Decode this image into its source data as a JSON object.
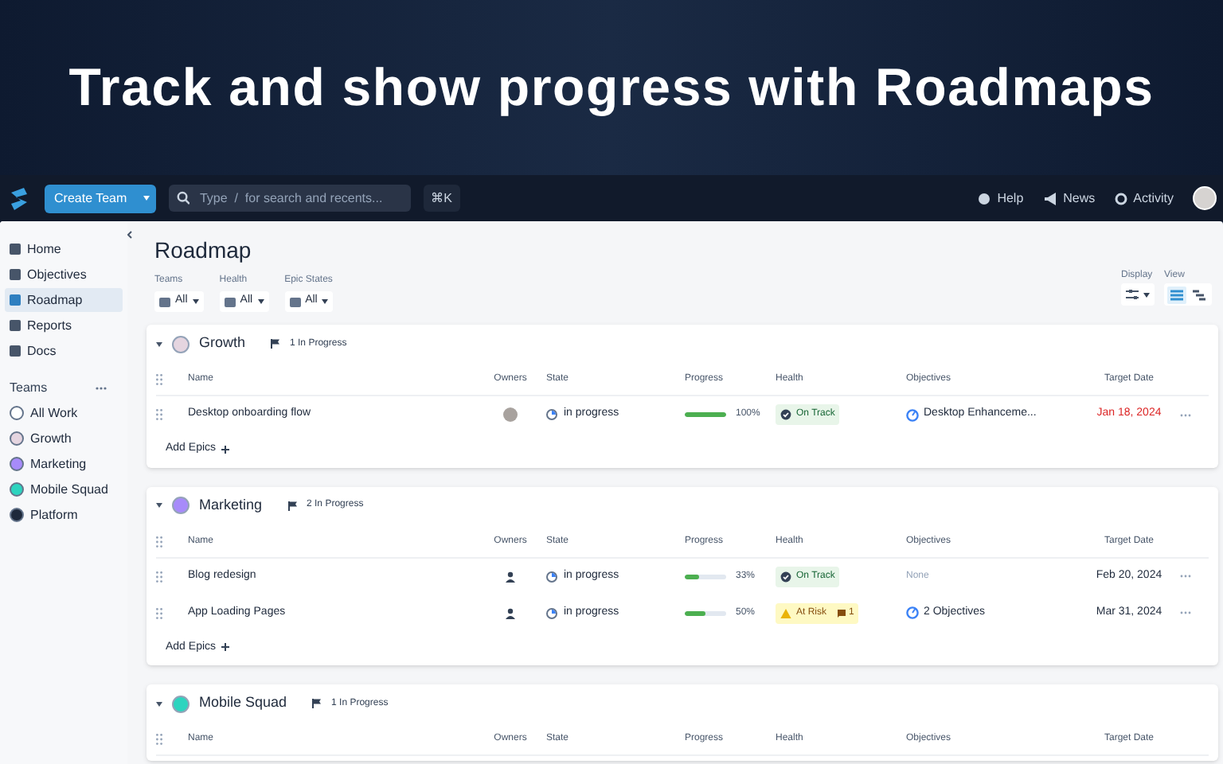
{
  "headline": "Track and show progress with Roadmaps",
  "topbar": {
    "create_button": "Create Team",
    "search": {
      "placeholder": "Type  /  for search and recents..."
    },
    "shortcut": "⌘K",
    "links": [
      "Help",
      "News",
      "Activity"
    ]
  },
  "sidebar": {
    "items": [
      {
        "label": "Home",
        "selected": false
      },
      {
        "label": "Objectives",
        "selected": false
      },
      {
        "label": "Roadmap",
        "selected": true
      },
      {
        "label": "Reports",
        "selected": false
      },
      {
        "label": "Docs",
        "selected": false
      }
    ],
    "teams_heading": "Teams",
    "teams": [
      {
        "label": "All Work",
        "color": "#ffffff"
      },
      {
        "label": "Growth",
        "color": "#e5d5e0"
      },
      {
        "label": "Marketing",
        "color": "#a78bfa"
      },
      {
        "label": "Mobile Squad",
        "color": "#2dd4bf"
      },
      {
        "label": "Platform",
        "color": "#1e293b"
      }
    ]
  },
  "page": {
    "title": "Roadmap",
    "filters": [
      {
        "label": "Teams",
        "value": "All"
      },
      {
        "label": "Health",
        "value": "All"
      },
      {
        "label": "Epic States",
        "value": "All"
      }
    ],
    "display_label": "Display",
    "view_label": "View",
    "views": [
      {
        "selected": true
      },
      {
        "selected": false
      }
    ]
  },
  "groups": [
    {
      "name": "Growth",
      "color": "#e5d5e0",
      "count": "1 In Progress",
      "expanded": true,
      "columns": [
        "Name",
        "Owners",
        "State",
        "Progress",
        "Health",
        "Objectives",
        "Target Date"
      ],
      "add_label": "Add Epics",
      "rows": [
        {
          "name": "Desktop onboarding flow",
          "assigned": true,
          "state": "in progress",
          "level": 1.0,
          "percent": "100%",
          "health": {
            "kind": "on_track",
            "label": "On Track"
          },
          "objectives": {
            "kind": "link",
            "label": "Desktop Enhanceme..."
          },
          "target_date": "Jan 18, 2024",
          "overdue": true
        }
      ]
    },
    {
      "name": "Marketing",
      "color": "#a78bfa",
      "count": "2 In Progress",
      "expanded": true,
      "columns": [
        "Name",
        "Owners",
        "State",
        "Progress",
        "Health",
        "Objectives",
        "Target Date"
      ],
      "add_label": "Add Epics",
      "rows": [
        {
          "name": "Blog redesign",
          "assigned": false,
          "state": "in progress",
          "level": 0.33,
          "percent": "33%",
          "health": {
            "kind": "on_track",
            "label": "On Track"
          },
          "objectives": {
            "kind": "none",
            "label": "None"
          },
          "target_date": "Feb 20, 2024",
          "overdue": false
        },
        {
          "name": "App Loading Pages",
          "assigned": false,
          "state": "in progress",
          "level": 0.5,
          "percent": "50%",
          "health": {
            "kind": "at_risk",
            "label": "At Risk",
            "comments": "1"
          },
          "objectives": {
            "kind": "link",
            "label": "2 Objectives"
          },
          "target_date": "Mar 31, 2024",
          "overdue": false
        }
      ]
    },
    {
      "name": "Mobile Squad",
      "color": "#2dd4bf",
      "count": "1 In Progress",
      "expanded": true,
      "columns": [
        "Name",
        "Owners",
        "State",
        "Progress",
        "Health",
        "Objectives",
        "Target Date"
      ]
    }
  ]
}
